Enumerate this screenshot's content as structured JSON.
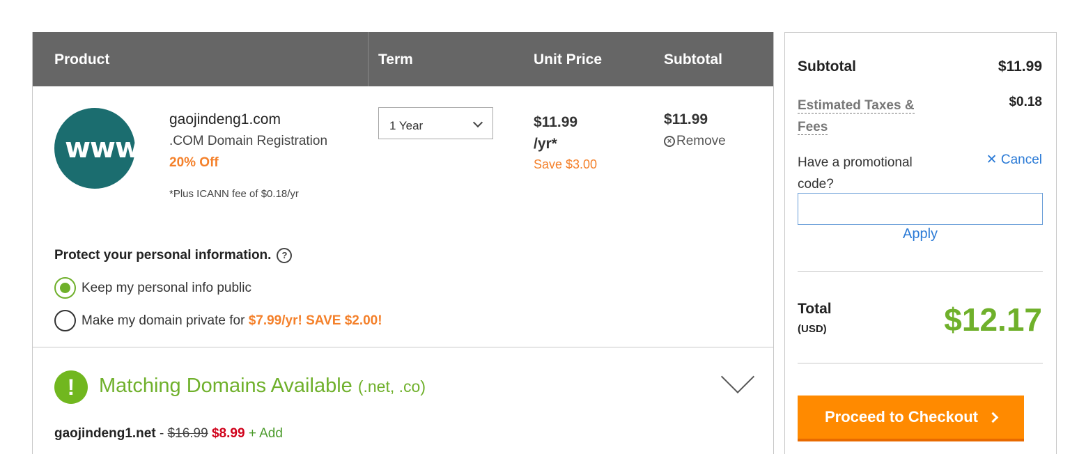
{
  "table": {
    "headers": {
      "product": "Product",
      "term": "Term",
      "unit_price": "Unit Price",
      "subtotal": "Subtotal"
    }
  },
  "item": {
    "logo_text": "www",
    "domain": "gaojindeng1.com",
    "description": ".COM Domain Registration",
    "discount": "20% Off",
    "icann_note": "*Plus ICANN fee of $0.18/yr",
    "term_selected": "1 Year",
    "unit_price": "$11.99",
    "unit_suffix": "/yr*",
    "save": "Save $3.00",
    "subtotal": "$11.99",
    "remove_label": "Remove"
  },
  "privacy": {
    "heading": "Protect your personal information.",
    "help_icon": "?",
    "option_public": "Keep my personal info public",
    "option_private": "Make my domain private for ",
    "option_private_promo": "$7.99/yr! SAVE $2.00!",
    "selected": "public"
  },
  "matching": {
    "icon": "!",
    "title": "Matching Domains Available ",
    "extensions": "(.net, .co)",
    "suggestion": {
      "domain": "gaojindeng1.net",
      "separator": " - ",
      "old_price": "$16.99",
      "new_price": "$8.99",
      "add_label": "+ Add"
    }
  },
  "summary": {
    "subtotal_label": "Subtotal",
    "subtotal_value": "$11.99",
    "taxes_label_1": "Estimated Taxes &",
    "taxes_label_2": "Fees",
    "taxes_value": "$0.18",
    "promo_question": "Have a promotional code?",
    "cancel_label": "Cancel",
    "promo_value": "",
    "apply_label": "Apply",
    "total_label": "Total",
    "currency": "(USD)",
    "total_value": "$12.17",
    "checkout_label": "Proceed to Checkout"
  },
  "colors": {
    "header_bg": "#666666",
    "accent_orange": "#f4802a",
    "accent_green": "#6fb02b",
    "link_blue": "#2a7ad6",
    "checkout_orange": "#ff8a00",
    "sale_red": "#d0021b"
  }
}
